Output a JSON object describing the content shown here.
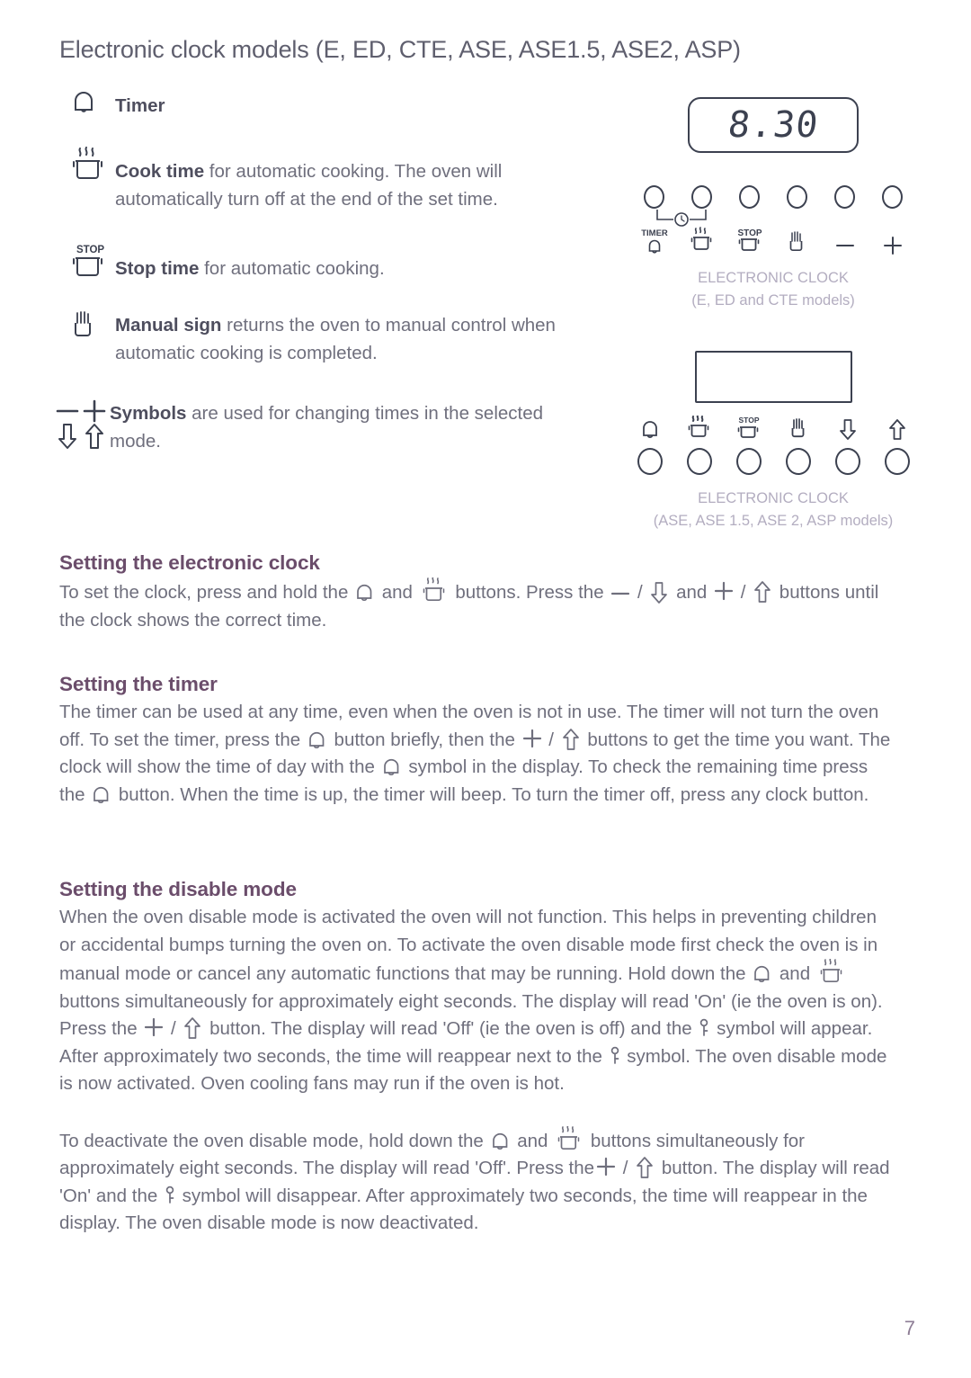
{
  "document": {
    "title": "Electronic clock models (E, ED, CTE, ASE, ASE1.5, ASE2, ASP)",
    "page_number": "7"
  },
  "colors": {
    "heading": "#6b4d6b",
    "body": "#6f6f7d",
    "caption": "#b3adc0",
    "line_art": "#3c4150",
    "page_number": "#8d7d95"
  },
  "legend": {
    "items": [
      {
        "icon": "bell-icon",
        "bold": "Timer",
        "rest": ""
      },
      {
        "icon": "cook-pot-steam-icon",
        "bold": "Cook time",
        "rest": " for automatic cooking. The oven will automatically turn off at the end of the set time."
      },
      {
        "icon": "stop-pot-icon",
        "bold": "Stop time",
        "rest": " for automatic cooking."
      },
      {
        "icon": "hand-icon",
        "bold": "Manual sign",
        "rest": " returns the oven to manual control when automatic cooking is completed."
      },
      {
        "icon": "minus-plus-down-up-icons",
        "bold": "Symbols",
        "rest": " are used for changing times in the selected mode."
      }
    ]
  },
  "diagrams": [
    {
      "display_value": "8.30",
      "display_type": "rounded-lcd",
      "knob_position": "above",
      "buttons": [
        {
          "icon": "bell-icon",
          "label": "TIMER"
        },
        {
          "icon": "cook-pot-steam-icon",
          "label": ""
        },
        {
          "icon": "stop-pot-icon",
          "label": "STOP"
        },
        {
          "icon": "hand-icon",
          "label": ""
        },
        {
          "icon": "minus-icon",
          "label": ""
        },
        {
          "icon": "plus-icon",
          "label": ""
        }
      ],
      "caption_line1": "ELECTRONIC CLOCK",
      "caption_line2": "(E, ED and CTE models)"
    },
    {
      "display_value": "",
      "display_type": "rectangular-blank",
      "knob_position": "below",
      "buttons": [
        {
          "icon": "bell-icon",
          "label": ""
        },
        {
          "icon": "cook-pot-steam-icon",
          "label": ""
        },
        {
          "icon": "stop-pot-icon",
          "label": "STOP"
        },
        {
          "icon": "hand-icon",
          "label": ""
        },
        {
          "icon": "arrow-down-icon",
          "label": ""
        },
        {
          "icon": "arrow-up-icon",
          "label": ""
        }
      ],
      "caption_line1": "ELECTRONIC CLOCK",
      "caption_line2": "(ASE, ASE 1.5, ASE 2, ASP models)"
    }
  ],
  "sections": [
    {
      "id": "setting-the-electronic-clock",
      "heading": "Setting the electronic clock",
      "text_parts": [
        "To set the clock, press and hold the ",
        " and ",
        " buttons. Press the ",
        " / ",
        " and ",
        " / ",
        " buttons until the clock shows the correct time."
      ]
    },
    {
      "id": "setting-the-timer",
      "heading": "Setting the timer",
      "text_parts": [
        "The timer can be used at any time, even when the oven is not in use. The timer will not turn the oven off.  To set the timer, press the ",
        " button briefly, then the ",
        " / ",
        " buttons to get the time you want. The clock will show the time of day with the ",
        " symbol in the display.  To check the remaining time press the ",
        " button.  When the time is up, the timer will beep. To turn the timer off, press any clock button."
      ]
    },
    {
      "id": "setting-the-disable-mode",
      "heading": "Setting the disable mode",
      "paragraph_1_parts": [
        "When the oven disable mode is activated the oven will not function.  This helps in preventing children or accidental bumps turning the oven on.  To activate the oven disable mode first check the oven is in manual mode or cancel any automatic functions that may be running.  Hold down the ",
        " and ",
        " buttons simultaneously for approximately eight seconds.  The display will read 'On' (ie the oven is on).  Press the ",
        " / ",
        " button.  The display will read 'Off' (ie the oven is off) and the ",
        " symbol will appear.  After approximately two seconds, the time will reappear next to the ",
        " symbol.  The oven disable mode is now activated. Oven cooling fans may run if the oven is hot."
      ],
      "paragraph_2_parts": [
        "To deactivate the oven disable mode, hold down the ",
        " and ",
        " buttons simultaneously for approximately eight seconds.  The display will read 'Off'.  Press the",
        " / ",
        " button.  The display will read 'On' and the ",
        " symbol will disappear.  After approximately two seconds, the time will reappear in the display.  The oven disable mode is now deactivated."
      ]
    }
  ]
}
